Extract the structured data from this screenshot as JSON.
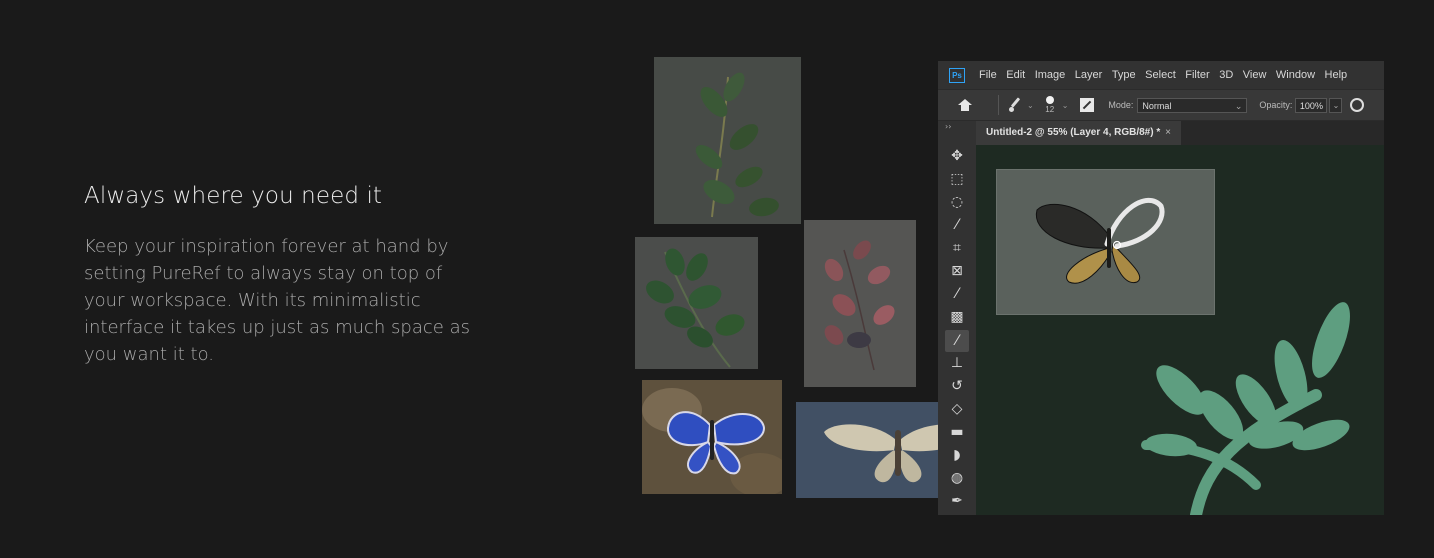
{
  "copy": {
    "headline": "Always where you need it",
    "body": "Keep your inspiration forever at hand by setting PureRef to always stay on top of your workspace. With its minimalistic interface it takes up just as much space as you want it to."
  },
  "photoshop": {
    "logo": "Ps",
    "menu": [
      "File",
      "Edit",
      "Image",
      "Layer",
      "Type",
      "Select",
      "Filter",
      "3D",
      "View",
      "Window",
      "Help"
    ],
    "options": {
      "brush_size": "12",
      "mode_label": "Mode:",
      "mode_value": "Normal",
      "opacity_label": "Opacity:",
      "opacity_value": "100%"
    },
    "document_tab": "Untitled-2 @ 55% (Layer 4, RGB/8#) *",
    "tab_close": "×",
    "tools": [
      "move-icon",
      "marquee-icon",
      "lasso-icon",
      "magic-wand-icon",
      "crop-icon",
      "frame-icon",
      "eyedropper-icon",
      "healing-brush-icon",
      "brush-icon",
      "stamp-icon",
      "history-brush-icon",
      "eraser-icon",
      "gradient-icon",
      "blur-icon",
      "dodge-icon",
      "pen-icon"
    ],
    "active_tool": "brush-icon"
  },
  "references": [
    "leaves-reference",
    "leaf-branch-reference",
    "berries-reference",
    "blue-butterfly-reference",
    "moth-reference"
  ],
  "colors": {
    "background": "#1a1a1a",
    "ps_accent": "#2fa3f6",
    "canvas_green": "#5e9e80"
  }
}
